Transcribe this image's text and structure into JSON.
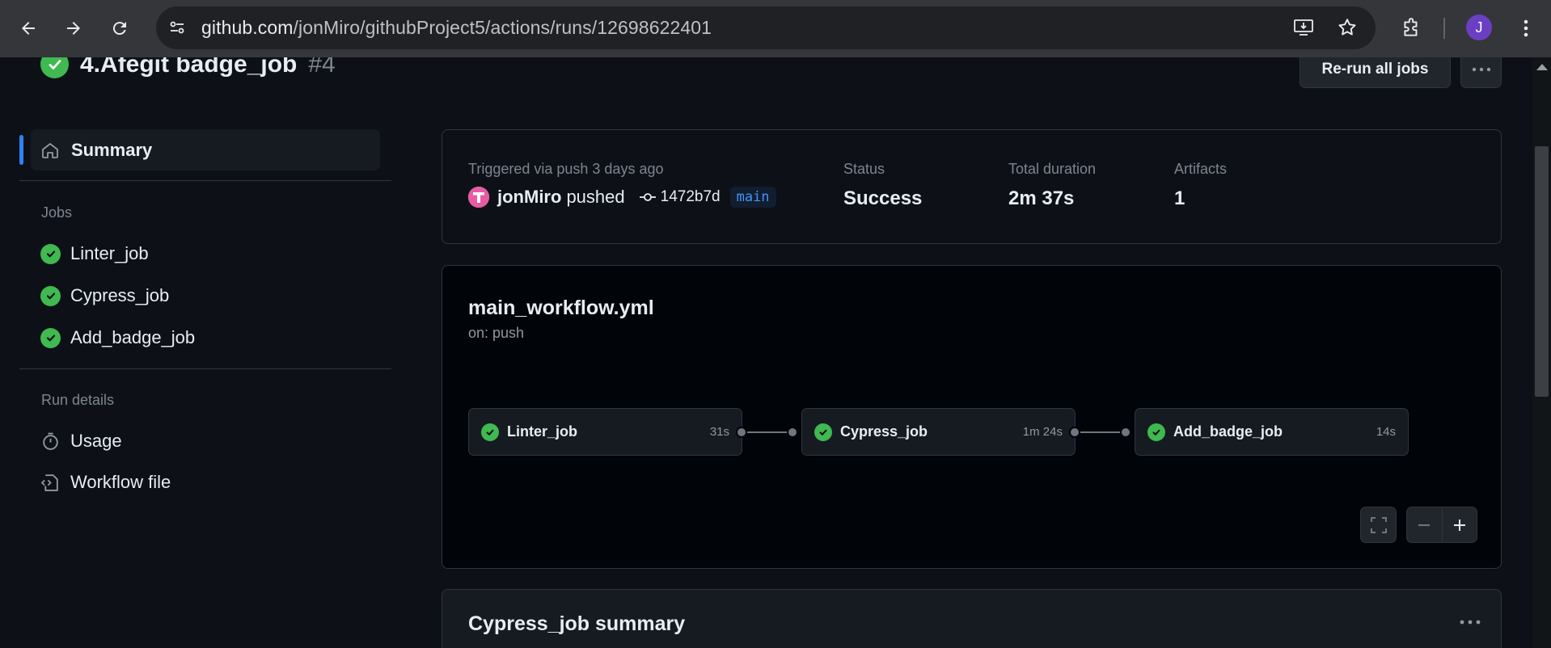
{
  "browser": {
    "url_host": "github.com",
    "url_path": "/jonMiro/githubProject5/actions/runs/12698622401",
    "profile_initial": "J"
  },
  "run": {
    "title": "4.Afegit badge_job",
    "number": "#4",
    "rerun_label": "Re-run all jobs"
  },
  "sidebar": {
    "summary_label": "Summary",
    "jobs_heading": "Jobs",
    "jobs": [
      {
        "label": "Linter_job"
      },
      {
        "label": "Cypress_job"
      },
      {
        "label": "Add_badge_job"
      }
    ],
    "run_details_heading": "Run details",
    "usage_label": "Usage",
    "workflow_file_label": "Workflow file"
  },
  "summary": {
    "triggered": "Triggered via push 3 days ago",
    "user": "jonMiro",
    "action": "pushed",
    "commit": "1472b7d",
    "branch": "main",
    "status_label": "Status",
    "status_value": "Success",
    "duration_label": "Total duration",
    "duration_value": "2m 37s",
    "artifacts_label": "Artifacts",
    "artifacts_value": "1"
  },
  "workflow": {
    "file": "main_workflow.yml",
    "trigger": "on: push",
    "jobs": [
      {
        "name": "Linter_job",
        "duration": "31s"
      },
      {
        "name": "Cypress_job",
        "duration": "1m 24s"
      },
      {
        "name": "Add_badge_job",
        "duration": "14s"
      }
    ]
  },
  "job_summary": {
    "title": "Cypress_job summary"
  },
  "colors": {
    "success": "#3fb950",
    "accent": "#2f81f7",
    "background": "#0d1117"
  }
}
